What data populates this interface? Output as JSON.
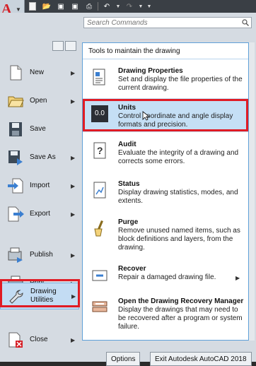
{
  "search": {
    "placeholder": "Search Commands"
  },
  "left_menu": [
    {
      "label": "New",
      "has_submenu": true
    },
    {
      "label": "Open",
      "has_submenu": true
    },
    {
      "label": "Save",
      "has_submenu": false
    },
    {
      "label": "Save As",
      "has_submenu": true
    },
    {
      "label": "Import",
      "has_submenu": true
    },
    {
      "label": "Export",
      "has_submenu": true
    },
    {
      "label": "Publish",
      "has_submenu": true
    },
    {
      "label": "Print",
      "has_submenu": true
    },
    {
      "label": "Drawing\nUtilities",
      "has_submenu": true,
      "active": true
    },
    {
      "label": "Close",
      "has_submenu": true
    }
  ],
  "panel": {
    "title": "Tools to maintain the drawing",
    "tools": [
      {
        "name": "Drawing Properties",
        "description": "Set and display the file properties of the current drawing."
      },
      {
        "name": "Units",
        "icon_text": "0.0",
        "description": "Control coordinate and angle display formats and precision.",
        "selected": true
      },
      {
        "name": "Audit",
        "description": "Evaluate the integrity of a drawing and corrects some errors."
      },
      {
        "name": "Status",
        "description": "Display drawing statistics, modes, and extents."
      },
      {
        "name": "Purge",
        "description": "Remove unused named items, such as block definitions and layers, from the drawing."
      },
      {
        "name": "Recover",
        "description": "Repair a damaged drawing file.",
        "has_submenu": true
      },
      {
        "name": "Open the Drawing Recovery Manager",
        "description": "Display the drawings that may need to be recovered after a program or system failure."
      }
    ]
  },
  "footer": {
    "options_label": "Options",
    "exit_label": "Exit Autodesk AutoCAD 2018"
  },
  "colors": {
    "highlight_red": "#e01b24",
    "accent_blue": "#5fa0d8",
    "brand_red": "#d51f26"
  }
}
